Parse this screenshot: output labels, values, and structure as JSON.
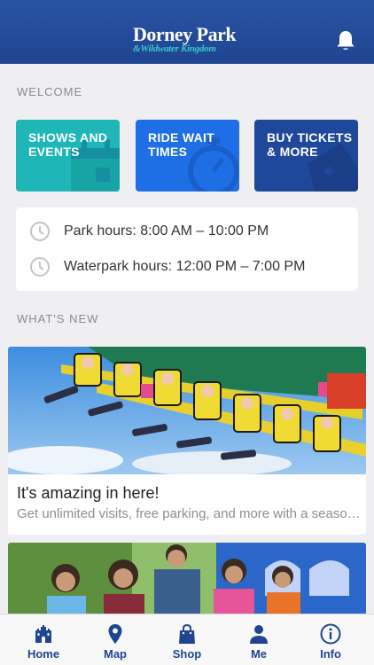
{
  "header": {
    "logo_main": "Dorney Park",
    "logo_sub": "&Wildwater Kingdom",
    "bell_icon": "bell-icon"
  },
  "welcome": {
    "label": "WELCOME",
    "tiles": [
      {
        "label": "SHOWS AND EVENTS",
        "icon": "calendar-icon",
        "color": "#1fb6b8"
      },
      {
        "label": "RIDE WAIT TIMES",
        "icon": "stopwatch-icon",
        "color": "#1e6ee6"
      },
      {
        "label": "BUY TICKETS & MORE",
        "icon": "ticket-icon",
        "color": "#1f479a"
      }
    ]
  },
  "hours": [
    {
      "text": "Park hours: 8:00 AM – 10:00 PM",
      "icon": "clock-icon"
    },
    {
      "text": "Waterpark hours: 12:00 PM – 7:00 PM",
      "icon": "clock-icon"
    }
  ],
  "whats_new": {
    "label": "WHAT'S NEW",
    "cards": [
      {
        "title": "It's amazing in here!",
        "description": "Get unlimited visits, free parking, and more with a season pass."
      },
      {
        "title": "",
        "description": ""
      }
    ]
  },
  "tabbar": {
    "tabs": [
      {
        "label": "Home",
        "icon": "castle-icon",
        "active": true
      },
      {
        "label": "Map",
        "icon": "map-pin-icon"
      },
      {
        "label": "Shop",
        "icon": "shopping-bag-icon"
      },
      {
        "label": "Me",
        "icon": "person-icon"
      },
      {
        "label": "Info",
        "icon": "info-icon"
      }
    ]
  },
  "colors": {
    "header": "#1f4591",
    "accent_teal": "#1fb6b8",
    "accent_blue": "#1e6ee6",
    "accent_navy": "#1f479a",
    "tab_active": "#1f4591"
  }
}
